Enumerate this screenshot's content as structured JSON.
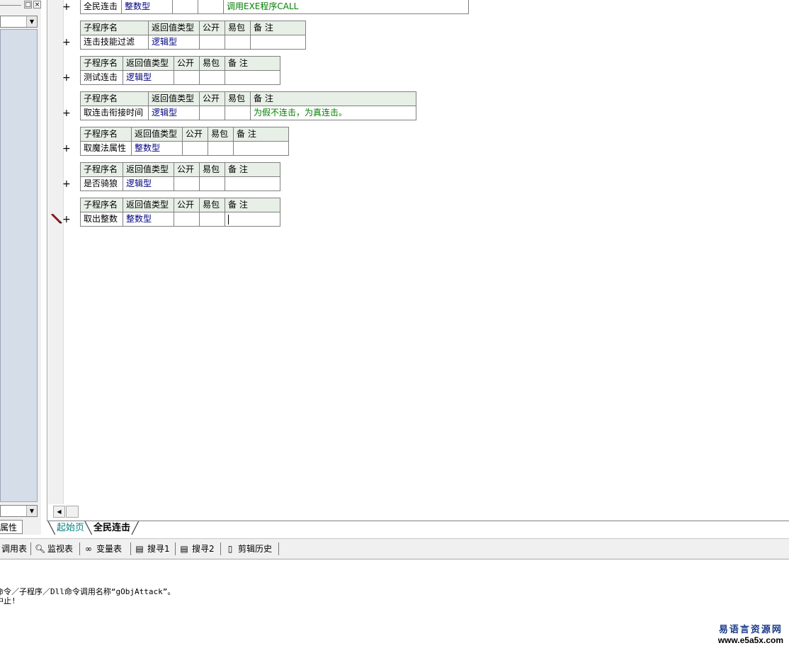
{
  "left_panel": {
    "bottom_tab_label": "属性"
  },
  "editor": {
    "top_row": {
      "name": "全民连击",
      "type": "整数型",
      "public": "",
      "easy": "",
      "note": "调用EXE程序CALL"
    },
    "header": {
      "name": "子程序名",
      "type": "返回值类型",
      "public": "公开",
      "easy": "易包",
      "note": "备 注"
    },
    "subroutines": [
      {
        "name": "连击技能过滤",
        "type": "逻辑型",
        "public": "",
        "easy": "",
        "note": ""
      },
      {
        "name": "测试连击",
        "type": "逻辑型",
        "public": "",
        "easy": "",
        "note": ""
      },
      {
        "name": "取连击衔接时间",
        "type": "逻辑型",
        "public": "",
        "easy": "",
        "note": "为假不连击，为真连击。"
      },
      {
        "name": "取魔法属性",
        "type": "整数型",
        "public": "",
        "easy": "",
        "note": ""
      },
      {
        "name": "是否骑狼",
        "type": "逻辑型",
        "public": "",
        "easy": "",
        "note": ""
      },
      {
        "name": "取出整数",
        "type": "整数型",
        "public": "",
        "easy": "",
        "note": ""
      }
    ],
    "expand_symbol": "+"
  },
  "tabs": {
    "start_page": "起始页",
    "current": "全民连击"
  },
  "toolbar": {
    "items": [
      {
        "label": "调用表",
        "icon": "table-icon"
      },
      {
        "label": "监视表",
        "icon": "magnifier-icon"
      },
      {
        "label": "变量表",
        "icon": "binoculars-icon"
      },
      {
        "label": "搜寻1",
        "icon": "search-doc-icon"
      },
      {
        "label": "搜寻2",
        "icon": "search-doc-icon"
      },
      {
        "label": "剪辑历史",
        "icon": "clipboard-icon"
      }
    ]
  },
  "output": {
    "line1": "命令／子程序／Dll命令调用名称“gObjAttack”。",
    "line2": "中止!"
  },
  "watermark": {
    "line1": "易语言资源网",
    "line2": "www.e5a5x.com"
  },
  "colors": {
    "header_bg": "#e7efe7",
    "type_text": "#000080",
    "note_text": "#008000",
    "tab_start": "#008080",
    "left_list_bg": "#d4dde8"
  }
}
